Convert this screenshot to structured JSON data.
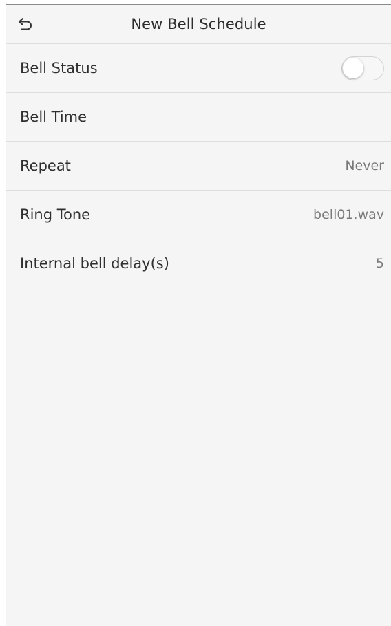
{
  "header": {
    "title": "New Bell Schedule",
    "back_icon": "back-arrow-icon"
  },
  "settings": {
    "bell_status": {
      "label": "Bell Status",
      "toggle_on": false
    },
    "bell_time": {
      "label": "Bell Time",
      "value": ""
    },
    "repeat": {
      "label": "Repeat",
      "value": "Never"
    },
    "ring_tone": {
      "label": "Ring Tone",
      "value": "bell01.wav"
    },
    "internal_delay": {
      "label": "Internal bell delay(s)",
      "value": "5"
    }
  },
  "colors": {
    "background": "#f5f5f5",
    "divider": "#dedede",
    "text": "#2f2f2f",
    "value_text": "#7a7a7a"
  }
}
